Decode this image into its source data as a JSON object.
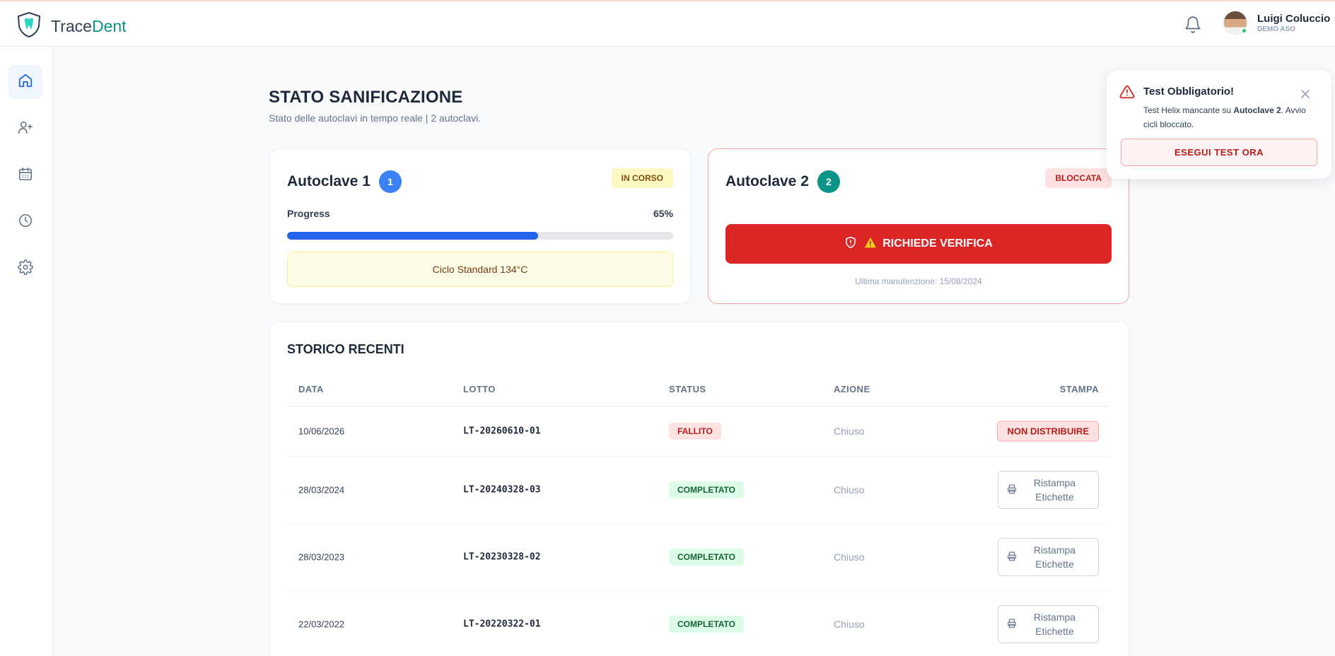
{
  "app": {
    "name_part1": "Trace",
    "name_part2": "Dent"
  },
  "colors": {
    "brand": "#0d9488",
    "primary": "#2563eb",
    "danger": "#dc2626"
  },
  "user": {
    "name": "Luigi Coluccio",
    "role": "DEMO ASO"
  },
  "sidebar": {
    "items": [
      {
        "icon": "home-icon",
        "active": true
      },
      {
        "icon": "add-user-icon",
        "active": false
      },
      {
        "icon": "calendar-icon",
        "active": false
      },
      {
        "icon": "clock-icon",
        "active": false
      },
      {
        "icon": "gear-icon",
        "active": false
      }
    ]
  },
  "page": {
    "title": "STATO SANIFICAZIONE",
    "subtitle": "Stato delle autoclavi in tempo reale | 2 autoclavi."
  },
  "autoclave1": {
    "name": "Autoclave 1",
    "number": "1",
    "status": "IN CORSO",
    "progress_label": "Progress",
    "progress_text": "65%",
    "progress_fraction": 0.65,
    "cycle": "Ciclo Standard 134°C"
  },
  "autoclave2": {
    "name": "Autoclave 2",
    "number": "2",
    "status": "BLOCCATA",
    "action": "RICHIEDE VERIFICA",
    "maintenance": "Ultima manutenzione: 15/08/2024"
  },
  "history": {
    "title": "STORICO RECENTI",
    "headers": {
      "date": "DATA",
      "lot": "LOTTO",
      "status": "STATUS",
      "action": "AZIONE",
      "print": "STAMPA"
    },
    "rows": [
      {
        "date": "10/06/2026",
        "lot": "LT-20260610-01",
        "status": "FALLITO",
        "action": "Chiuso",
        "print": "NON DISTRIBUIRE"
      },
      {
        "date": "28/03/2024",
        "lot": "LT-20240328-03",
        "status": "COMPLETATO",
        "action": "Chiuso",
        "print_line1": "Ristampa",
        "print_line2": "Etichette"
      },
      {
        "date": "28/03/2023",
        "lot": "LT-20230328-02",
        "status": "COMPLETATO",
        "action": "Chiuso",
        "print_line1": "Ristampa",
        "print_line2": "Etichette"
      },
      {
        "date": "22/03/2022",
        "lot": "LT-20220322-01",
        "status": "COMPLETATO",
        "action": "Chiuso",
        "print_line1": "Ristampa",
        "print_line2": "Etichette"
      }
    ]
  },
  "toast": {
    "title": "Test Obbligatorio!",
    "msg_part1": "Test Helix mancante su ",
    "msg_bold": "Autoclave 2",
    "msg_part2": ". Avvio cicli bloccato.",
    "button": "ESEGUI TEST ORA"
  }
}
